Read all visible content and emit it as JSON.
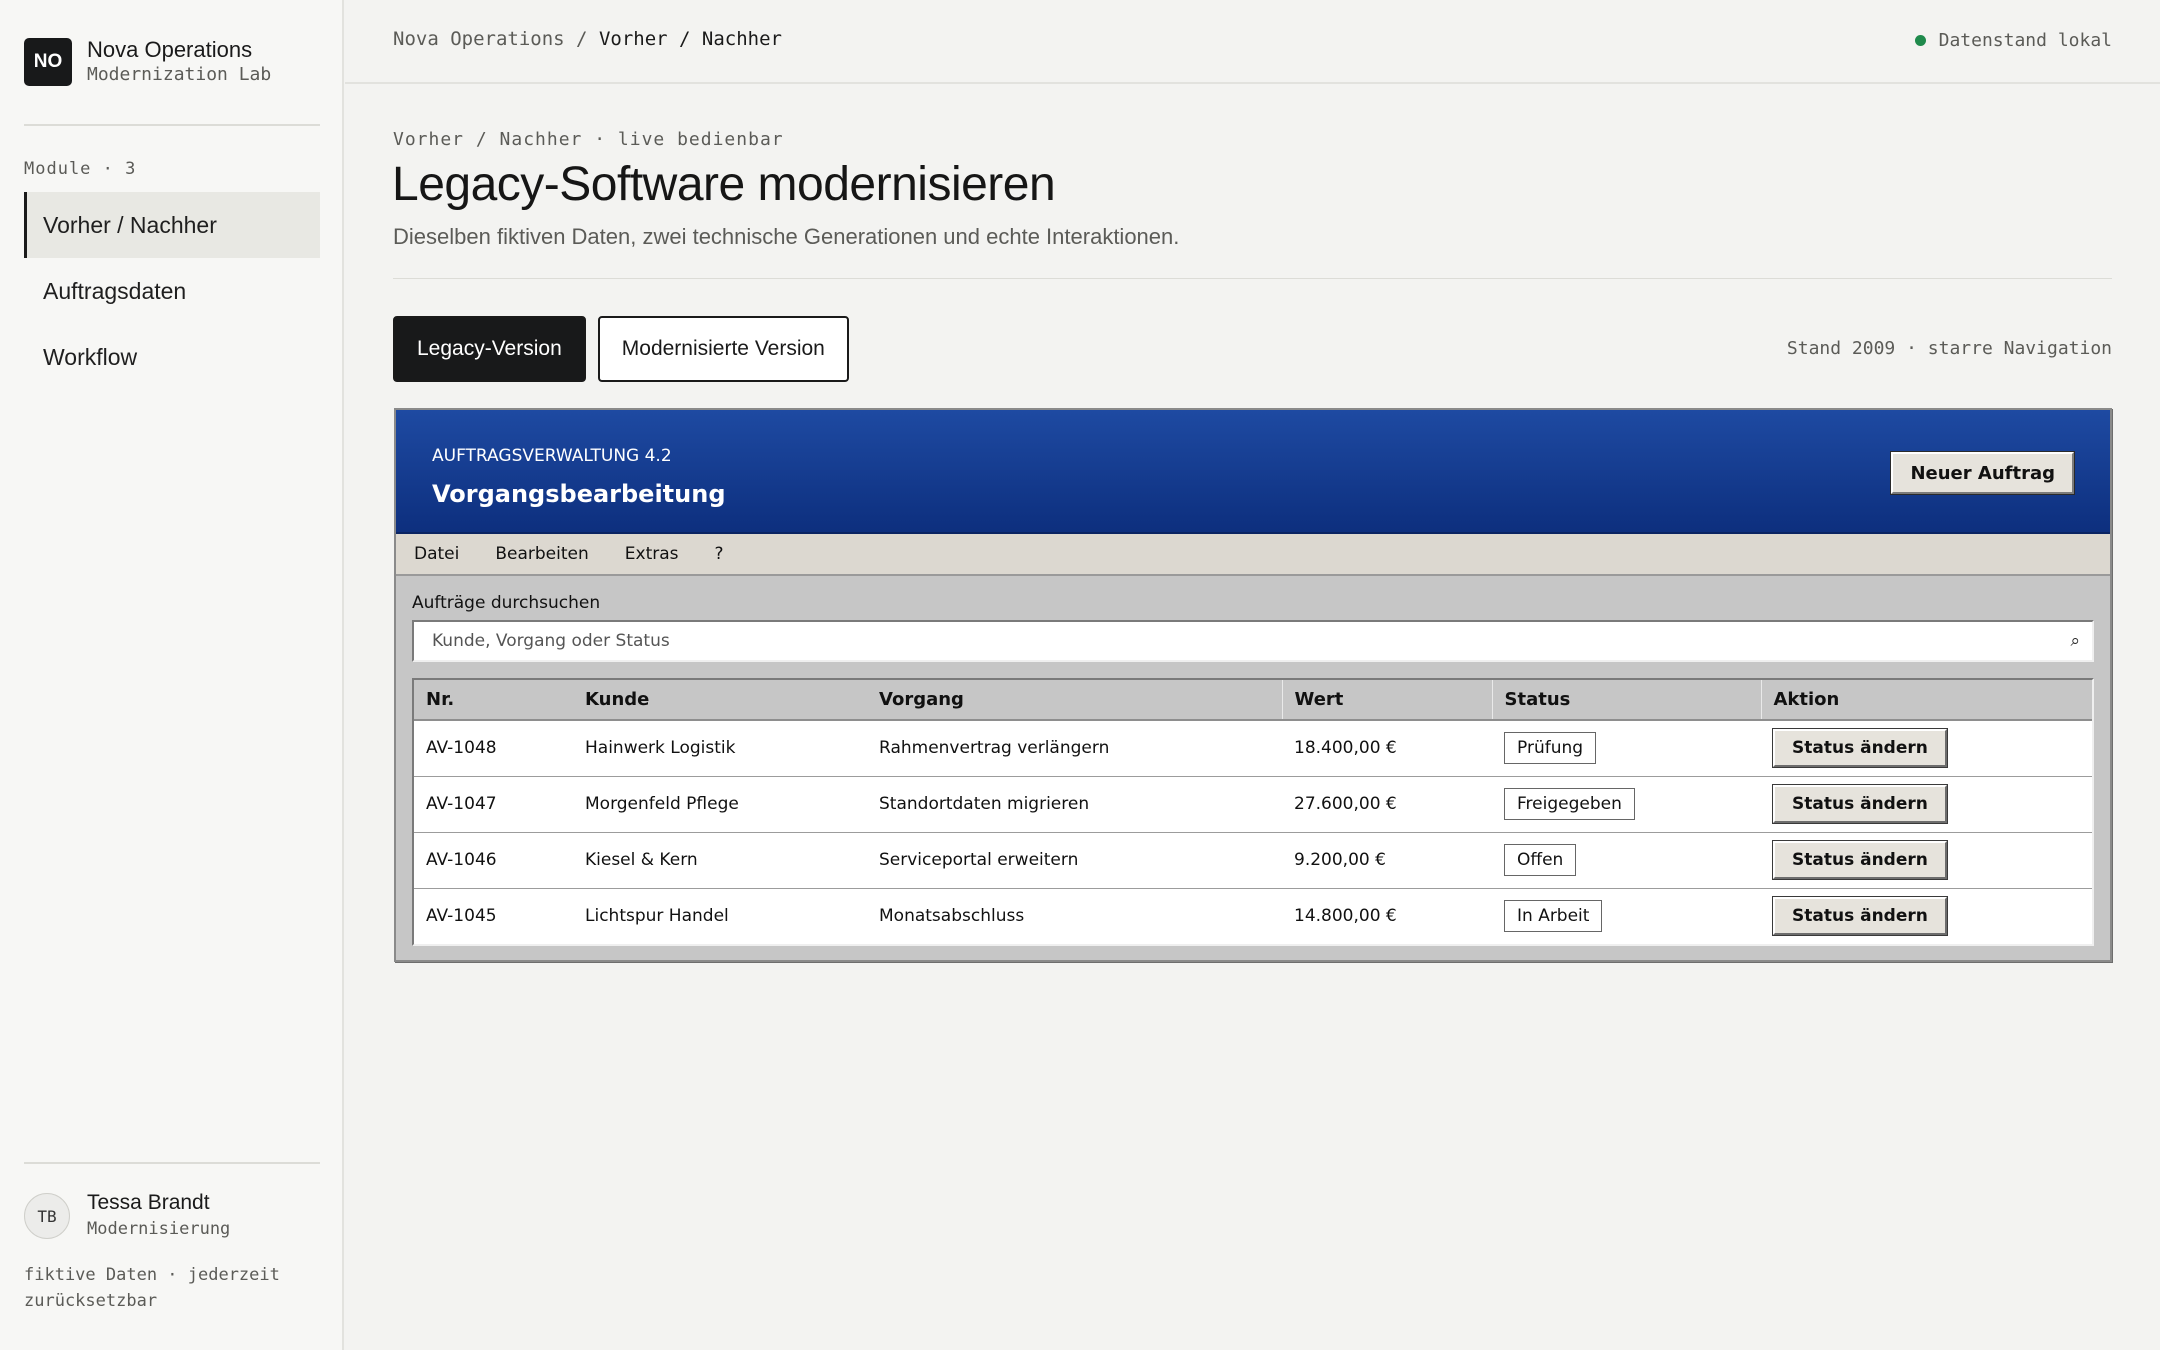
{
  "sidebar": {
    "logo": "NO",
    "brand_name": "Nova Operations",
    "brand_sub": "Modernization Lab",
    "module_label": "Module · 3",
    "items": [
      {
        "label": "Vorher / Nachher",
        "active": true
      },
      {
        "label": "Auftragsdaten",
        "active": false
      },
      {
        "label": "Workflow",
        "active": false
      }
    ],
    "user": {
      "initials": "TB",
      "name": "Tessa Brandt",
      "role": "Modernisierung"
    },
    "footnote": "fiktive Daten · jederzeit zurücksetzbar"
  },
  "topbar": {
    "crumb_root": "Nova Operations",
    "crumb_sep": "/",
    "crumb_current": "Vorher / Nachher",
    "data_status": "Datenstand lokal",
    "data_status_color": "#1f8a4c"
  },
  "header": {
    "eyebrow": "Vorher / Nachher · live bedienbar",
    "title": "Legacy-Software modernisieren",
    "subtitle": "Dieselben fiktiven Daten, zwei technische Generationen und echte Interaktionen."
  },
  "toggle": {
    "legacy_label": "Legacy-Version",
    "modern_label": "Modernisierte Version",
    "selected": "Legacy-Version",
    "stand": "Stand 2009 · starre Navigation"
  },
  "legacy": {
    "app_name": "AUFTRAGSVERWALTUNG 4.2",
    "title": "Vorgangsbearbeitung",
    "new_button": "Neuer Auftrag",
    "menu": [
      "Datei",
      "Bearbeiten",
      "Extras",
      "?"
    ],
    "search_label": "Aufträge durchsuchen",
    "search_placeholder": "Kunde, Vorgang oder Status",
    "search_value": "",
    "search_icon": "⌕",
    "columns": [
      "Nr.",
      "Kunde",
      "Vorgang",
      "Wert",
      "Status",
      "Aktion"
    ],
    "rows": [
      {
        "nr": "AV-1048",
        "kunde": "Hainwerk Logistik",
        "vorgang": "Rahmenvertrag verlängern",
        "wert": "18.400,00 €",
        "status": "Prüfung",
        "aktion": "Status ändern"
      },
      {
        "nr": "AV-1047",
        "kunde": "Morgenfeld Pflege",
        "vorgang": "Standortdaten migrieren",
        "wert": "27.600,00 €",
        "status": "Freigegeben",
        "aktion": "Status ändern"
      },
      {
        "nr": "AV-1046",
        "kunde": "Kiesel & Kern",
        "vorgang": "Serviceportal erweitern",
        "wert": "9.200,00 €",
        "status": "Offen",
        "aktion": "Status ändern"
      },
      {
        "nr": "AV-1045",
        "kunde": "Lichtspur Handel",
        "vorgang": "Monatsabschluss",
        "wert": "14.800,00 €",
        "status": "In Arbeit",
        "aktion": "Status ändern"
      }
    ]
  }
}
